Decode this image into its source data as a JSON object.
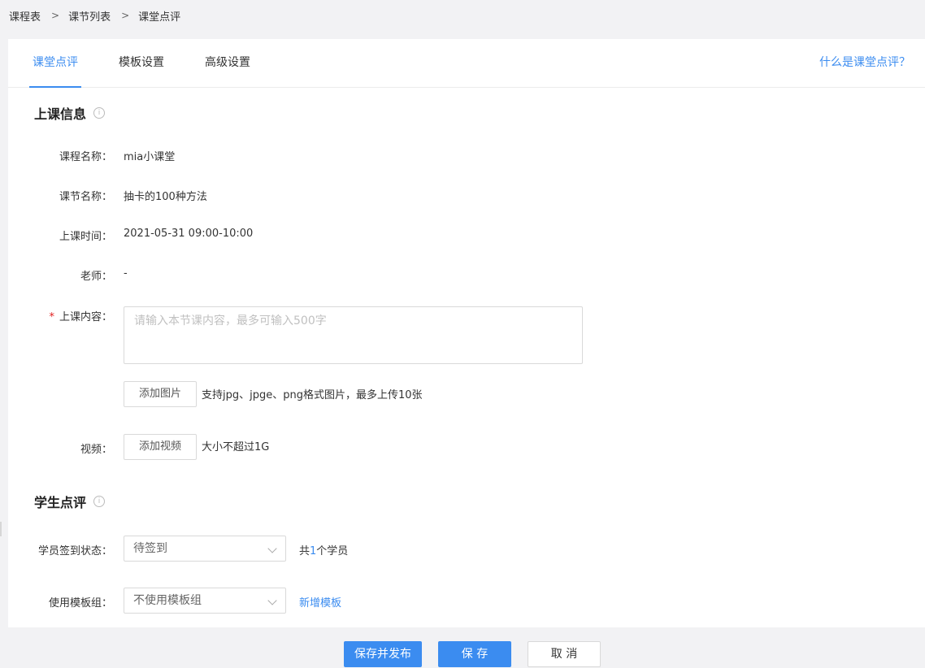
{
  "breadcrumb": {
    "items": [
      "课程表",
      "课节列表",
      "课堂点评"
    ],
    "separator": ">"
  },
  "tabs": [
    {
      "label": "课堂点评",
      "active": true
    },
    {
      "label": "模板设置",
      "active": false
    },
    {
      "label": "高级设置",
      "active": false
    }
  ],
  "help_link": "什么是课堂点评？",
  "class_info": {
    "title": "上课信息",
    "info_icon": "i",
    "course_name": {
      "label": "课程名称：",
      "value": "mia小课堂"
    },
    "lesson_name": {
      "label": "课节名称：",
      "value": "抽卡的100种方法"
    },
    "class_time": {
      "label": "上课时间：",
      "value": "2021-05-31 09:00-10:00"
    },
    "teacher": {
      "label": "老师：",
      "value": "-"
    },
    "content": {
      "required_mark": "*",
      "label": "上课内容：",
      "placeholder": "请输入本节课内容，最多可输入500字"
    },
    "images": {
      "button": "添加图片",
      "hint": "支持jpg、jpge、png格式图片，最多上传10张"
    },
    "video": {
      "label": "视频：",
      "button": "添加视频",
      "hint": "大小不超过1G"
    }
  },
  "student_review": {
    "title": "学生点评",
    "info_icon": "i",
    "checkin": {
      "label": "学员签到状态：",
      "selected": "待签到"
    },
    "count": {
      "prefix": "共",
      "number": "1",
      "suffix": "个学员"
    },
    "template": {
      "label": "使用模板组：",
      "selected": "不使用模板组",
      "link": "新增模板"
    }
  },
  "footer": {
    "save_publish": "保存并发布",
    "save": "保 存",
    "cancel": "取 消"
  },
  "colors": {
    "accent": "#3b8cf0",
    "required": "#e02020",
    "background": "#f2f2f4"
  }
}
